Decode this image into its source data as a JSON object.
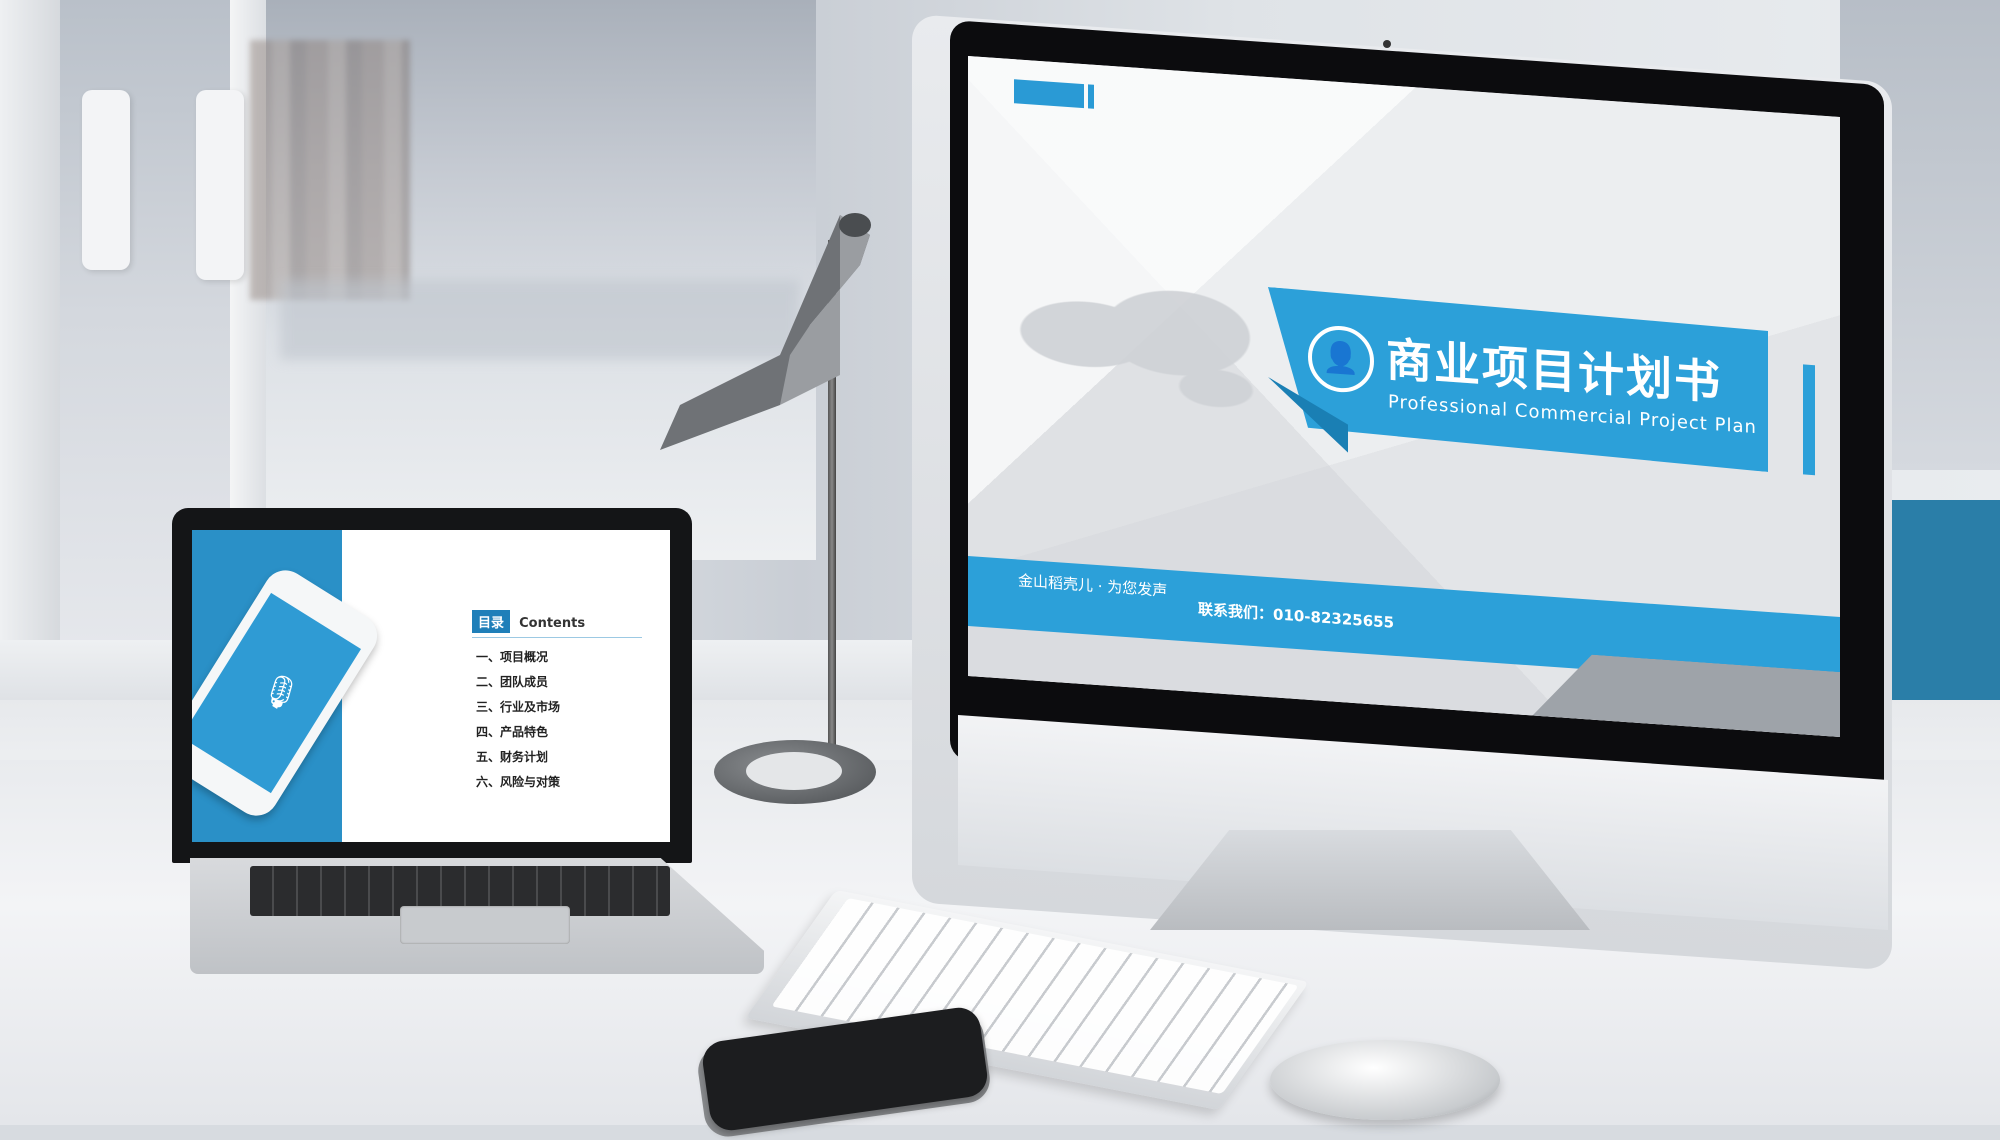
{
  "laptop": {
    "badge": "目录",
    "contents_title": "Contents",
    "items": [
      "一、项目概况",
      "二、团队成员",
      "三、行业及市场",
      "四、产品特色",
      "五、财务计划",
      "六、风险与对策"
    ],
    "icon": "microphone-icon"
  },
  "imac": {
    "title": "商业项目计划书",
    "subtitle": "Professional Commercial Project Plan",
    "footer_left": "金山稻壳儿 · 为您发声",
    "footer_right": "联系我们：010-82325655",
    "icon": "user-icon"
  },
  "colors": {
    "accent": "#2ca0d9",
    "accent_dark": "#1f7fb9"
  }
}
